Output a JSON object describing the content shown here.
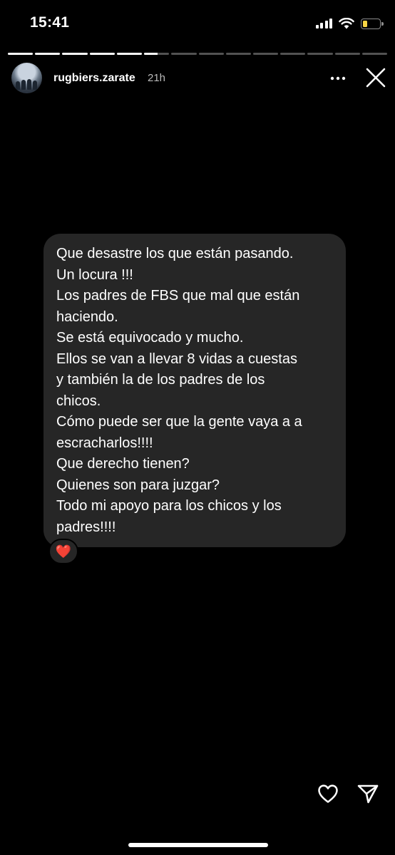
{
  "status_bar": {
    "time": "15:41",
    "signal_icon": "cellular-signal-icon",
    "wifi_icon": "wifi-icon",
    "battery_icon": "battery-icon",
    "battery_level": 0.3,
    "battery_color": "#f7d544"
  },
  "story": {
    "segments_total": 14,
    "segments_viewed": 5,
    "current_segment_progress": 0.55
  },
  "header": {
    "username": "rugbiers.zarate",
    "time_ago": "21h",
    "more_icon": "more-horizontal-icon",
    "close_icon": "close-icon"
  },
  "message": {
    "lines": [
      "Que desastre los que están pasando.",
      "Un locura !!!",
      "Los padres de FBS que mal que están",
      "haciendo.",
      "Se está equivocado y mucho.",
      "Ellos se van a llevar 8 vidas a cuestas",
      "y también la de los padres de los",
      "chicos.",
      "Cómo puede ser que la gente vaya a a",
      "escracharlos!!!!",
      "Que derecho tienen?",
      "Quienes son para juzgar?",
      "Todo mi apoyo para los chicos y los",
      "padres!!!!"
    ],
    "reaction": "❤️",
    "bubble_color": "#262626"
  },
  "actions": {
    "like_icon": "heart-outline-icon",
    "share_icon": "send-icon"
  }
}
